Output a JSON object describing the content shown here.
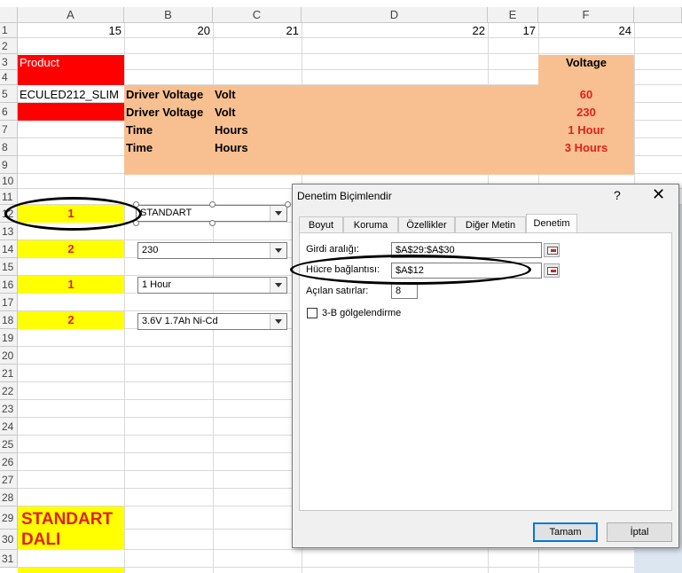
{
  "columns": [
    "A",
    "B",
    "C",
    "D",
    "E",
    "F"
  ],
  "rows": [
    "1",
    "2",
    "3",
    "4",
    "5",
    "6",
    "7",
    "8",
    "9",
    "10",
    "11",
    "12",
    "13",
    "14",
    "15",
    "16",
    "17",
    "18",
    "19",
    "20",
    "21",
    "22",
    "23",
    "24",
    "25",
    "26",
    "27",
    "28",
    "29",
    "30",
    "31"
  ],
  "row1": {
    "A": "15",
    "B": "20",
    "C": "21",
    "D": "22",
    "E": "17",
    "F": "24"
  },
  "product_label": "Product",
  "voltage_label": "Voltage",
  "model": "ECULED212_SLIM",
  "params": [
    {
      "name": "Driver Voltage",
      "unit": "Volt",
      "value": "60"
    },
    {
      "name": "Driver Voltage",
      "unit": "Volt",
      "value": "230"
    },
    {
      "name": "Time",
      "unit": "Hours",
      "value": "1 Hour"
    },
    {
      "name": "Time",
      "unit": "Hours",
      "value": "3 Hours"
    }
  ],
  "index_cells": [
    "1",
    "2",
    "1",
    "2"
  ],
  "combos": [
    "STANDART",
    "230",
    "1 Hour",
    "3.6V 1.7Ah Ni-Cd"
  ],
  "bottom_label": {
    "line1": "STANDART",
    "line2": "DALI"
  },
  "dialog": {
    "title": "Denetim Biçimlendir",
    "help": "?",
    "close": "✕",
    "tabs": [
      "Boyut",
      "Koruma",
      "Özellikler",
      "Diğer Metin",
      "Denetim"
    ],
    "input_range_label": "Girdi aralığı:",
    "input_range_value": "$A$29:$A$30",
    "cell_link_label": "Hücre bağlantısı:",
    "cell_link_value": "$A$12",
    "dropdown_lines_label": "Açılan satırlar:",
    "dropdown_lines_value": "8",
    "shading_label": "3-B gölgelendirme",
    "ok": "Tamam",
    "cancel": "İptal"
  },
  "colors": {
    "red": "#ff0000",
    "peach": "#f8c090",
    "yellow": "#ffff00",
    "text_red": "#e0201c",
    "accent": "#0078d7"
  }
}
